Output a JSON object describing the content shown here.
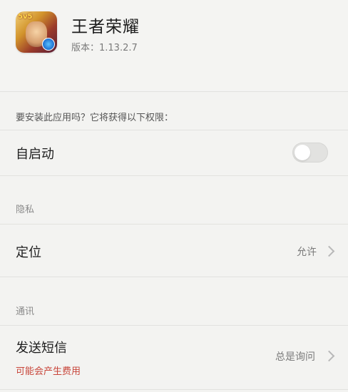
{
  "app": {
    "name": "王者荣耀",
    "version": "版本：1.13.2.7",
    "icon_badge": "5v5"
  },
  "prompt": "要安装此应用吗？它将获得以下权限：",
  "permissions": {
    "autostart": {
      "label": "自启动",
      "enabled": false
    },
    "privacy_section": "隐私",
    "location": {
      "label": "定位",
      "value": "允许"
    },
    "comm_section": "通讯",
    "sms": {
      "label": "发送短信",
      "value": "总是询问",
      "warning": "可能会产生费用"
    }
  },
  "colors": {
    "background": "#f3f3f1",
    "warning": "#c8463a",
    "muted": "#7a7a7a"
  }
}
